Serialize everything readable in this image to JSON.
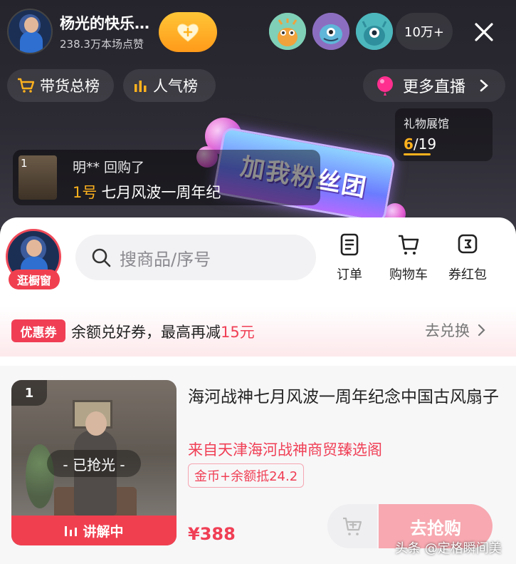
{
  "header": {
    "host_name": "杨光的快乐…",
    "host_likes": "238.3万本场点赞",
    "viewer_count": "10万+"
  },
  "rank_pills": [
    {
      "label": "带货总榜",
      "icon": "cart-icon"
    },
    {
      "label": "人气榜",
      "icon": "bar-chart-icon"
    }
  ],
  "more_live": {
    "label": "更多直播",
    "icon": "chevron-right-icon"
  },
  "gift_hall": {
    "title": "礼物展馆",
    "current": "6",
    "total": "/19"
  },
  "fan_sign": {
    "text": "加我粉丝团"
  },
  "repurchase": {
    "thumb_num": "1",
    "user_text": "明** 回购了",
    "product_no": "1号",
    "product_name": "七月风波一周年纪"
  },
  "shop": {
    "window_tag": "逛橱窗",
    "search_placeholder": "搜商品/序号",
    "actions": [
      {
        "label": "订单",
        "icon": "order-icon"
      },
      {
        "label": "购物车",
        "icon": "shopping-cart-icon"
      },
      {
        "label": "券红包",
        "icon": "coupon-icon"
      }
    ]
  },
  "coupon": {
    "badge": "优惠券",
    "text_prefix": "余额兑好券，最高再减",
    "amount": "15元",
    "action": "去兑换"
  },
  "product": {
    "number": "1",
    "status": "- 已抢光 -",
    "explaining": "讲解中",
    "title": "海河战神七月风波一周年纪念中国古风扇子",
    "source": "来自天津海河战神商贸臻选阁",
    "tag": "金币+余额抵24.2",
    "price": "¥388",
    "buy_label": "去抢购"
  },
  "watermark": "头条 @定格瞬间美",
  "colors": {
    "accent": "#f03f55",
    "gold": "#ffb21e"
  }
}
